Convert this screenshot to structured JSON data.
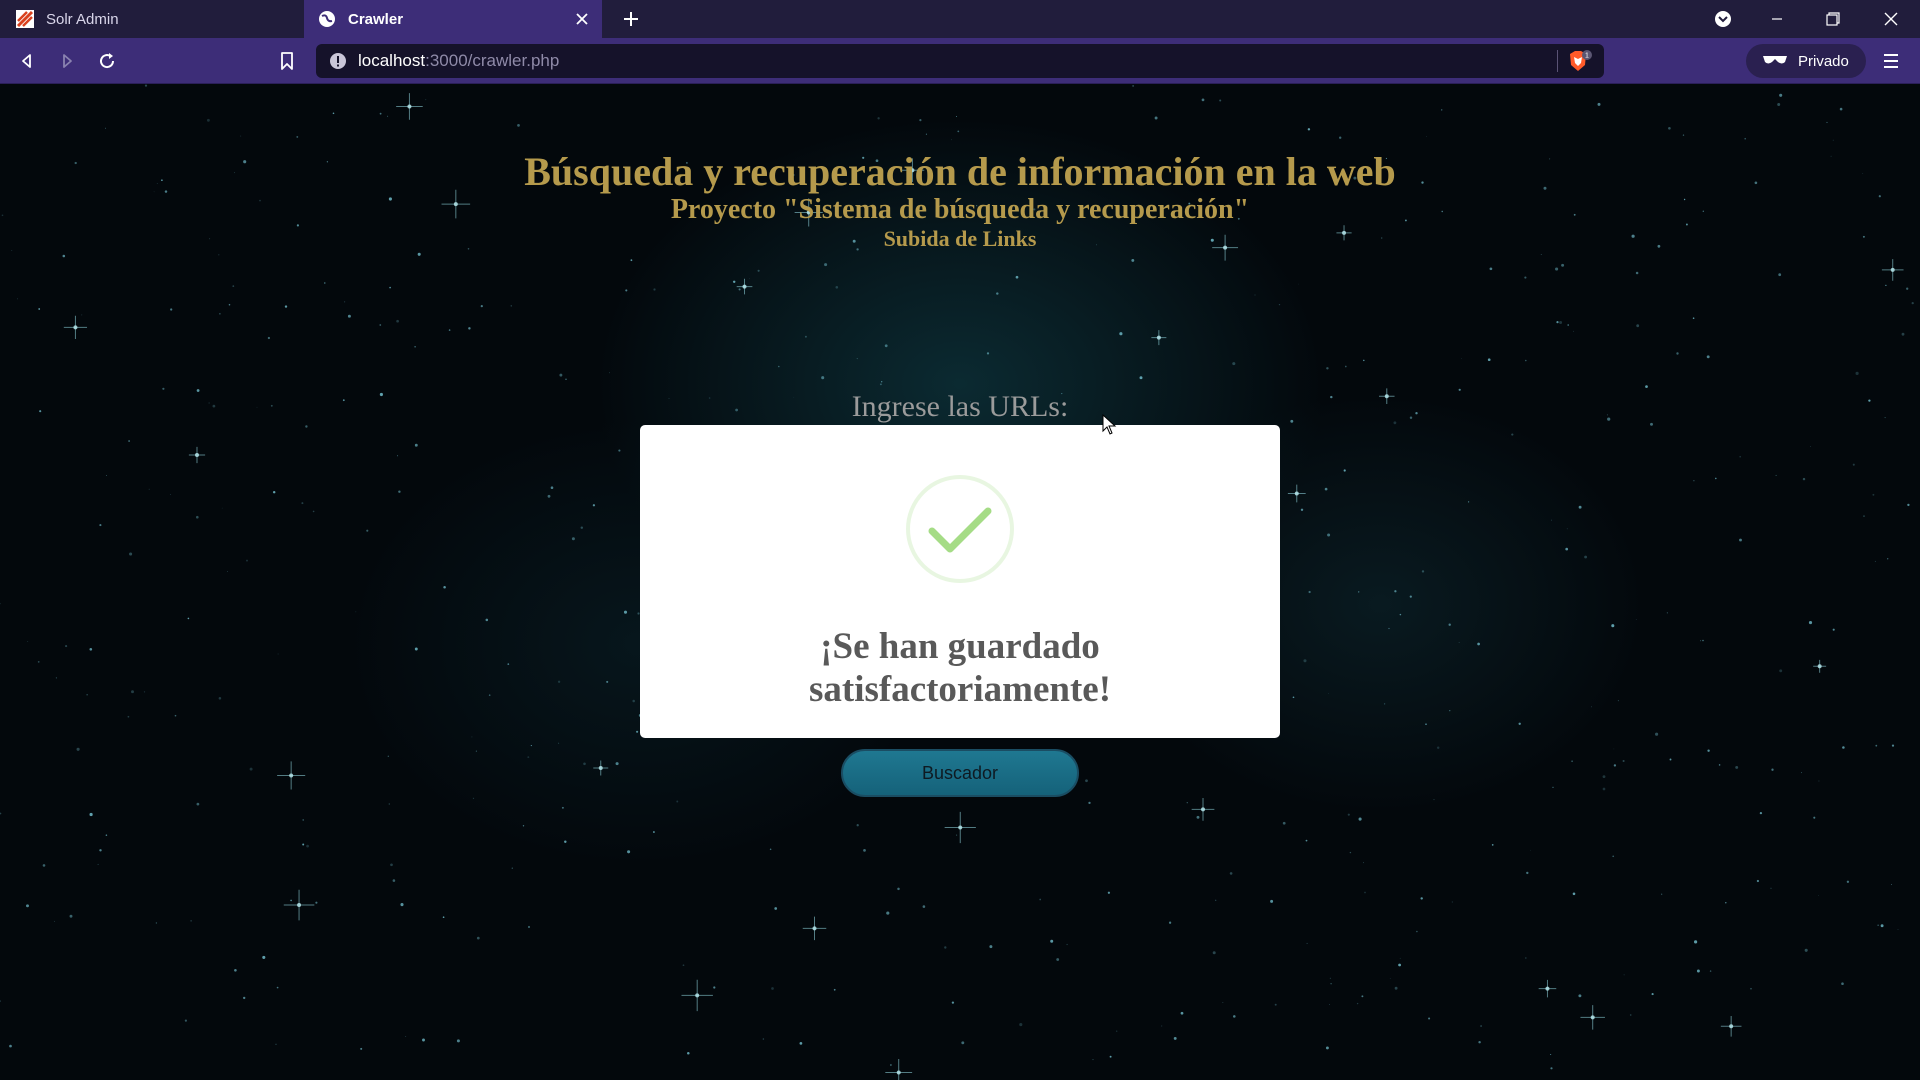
{
  "browser": {
    "tabs": [
      {
        "label": "Solr Admin",
        "active": false
      },
      {
        "label": "Crawler",
        "active": true
      }
    ],
    "url_host": "localhost",
    "url_rest": ":3000/crawler.php",
    "shield_count": "1",
    "private_label": "Privado"
  },
  "page": {
    "title": "Búsqueda y recuperación de información en la web",
    "subtitle": "Proyecto \"Sistema de búsqueda y recuperación\"",
    "section": "Subida de Links",
    "url_prompt": "Ingrese las URLs:",
    "button_label": "Buscador"
  },
  "modal": {
    "icon": "success-check-icon",
    "message_line1": "¡Se han guardado",
    "message_line2": "satisfactoriamente!"
  },
  "colors": {
    "heading": "#b59a4c",
    "toolbar": "#3d2d78",
    "button": "#1f7891",
    "check": "#a5dc86"
  }
}
